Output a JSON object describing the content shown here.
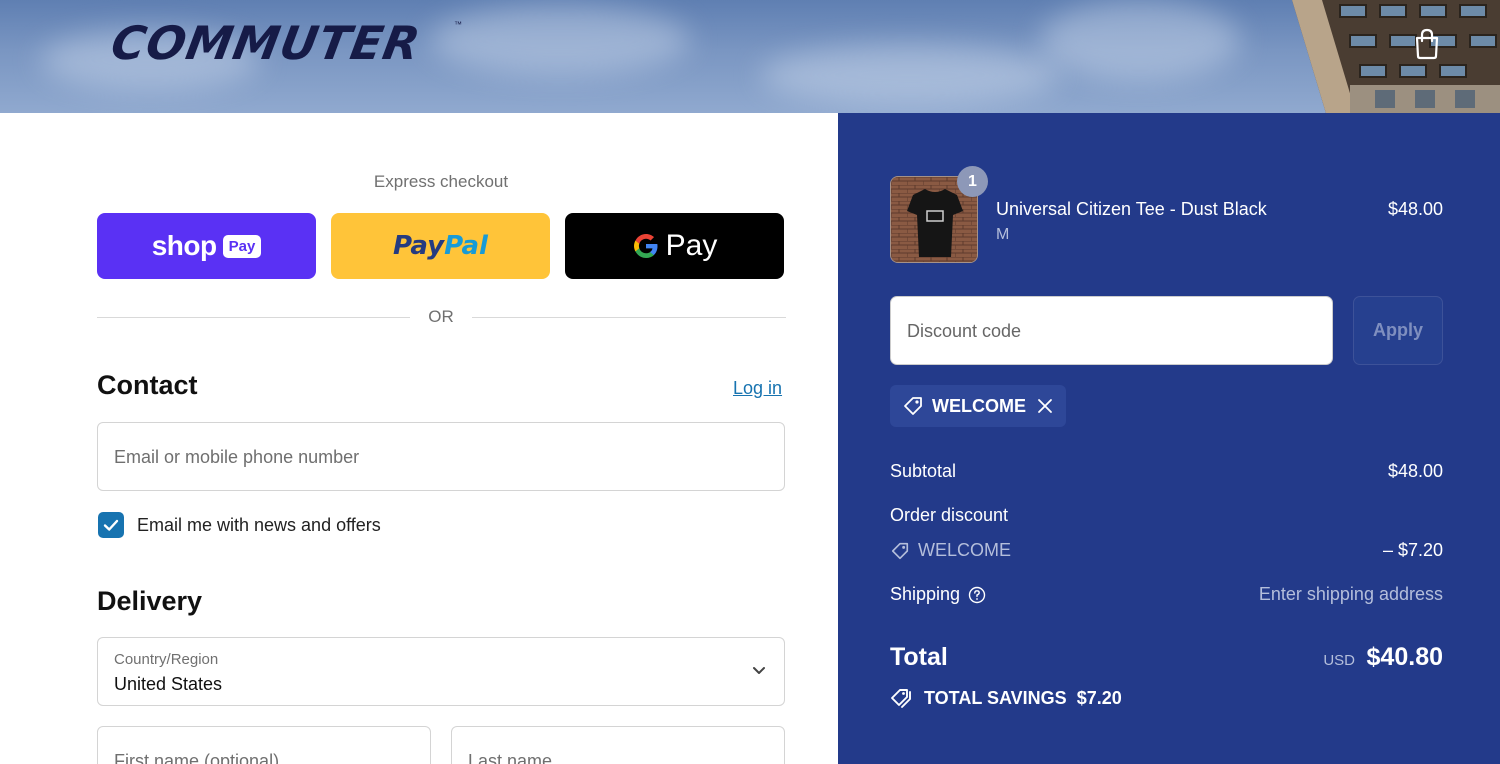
{
  "brand": {
    "logo_text": "COMMUTER",
    "logo_mark": "™"
  },
  "header": {
    "cart_icon": "shopping-bag-icon"
  },
  "express": {
    "title": "Express checkout",
    "shop_pay": {
      "shop": "shop",
      "pay": "Pay"
    },
    "paypal": {
      "part1": "Pay",
      "part2": "Pal"
    },
    "gpay": {
      "g": "G",
      "pay": "Pay"
    },
    "or_text": "OR"
  },
  "contact": {
    "title": "Contact",
    "login_label": "Log in",
    "email_placeholder": "Email or mobile phone number",
    "newsletter_label": "Email me with news and offers",
    "newsletter_checked": true
  },
  "delivery": {
    "title": "Delivery",
    "country_label": "Country/Region",
    "country_value": "United States",
    "first_name_placeholder": "First name (optional)",
    "last_name_placeholder": "Last name"
  },
  "summary": {
    "item": {
      "name": "Universal Citizen Tee - Dust Black",
      "variant": "M",
      "price": "$48.00",
      "quantity": "1"
    },
    "discount_placeholder": "Discount code",
    "apply_label": "Apply",
    "applied_code": "WELCOME",
    "subtotal_label": "Subtotal",
    "subtotal_value": "$48.00",
    "order_discount_label": "Order discount",
    "discount_code": "WELCOME",
    "discount_value": "– $7.20",
    "shipping_label": "Shipping",
    "shipping_value": "Enter shipping address",
    "total_label": "Total",
    "currency": "USD",
    "total_value": "$40.80",
    "savings_label": "TOTAL SAVINGS",
    "savings_value": "$7.20"
  },
  "colors": {
    "summary_bg": "#233a8a",
    "shop_pay": "#5a31f4",
    "paypal": "#ffc439",
    "gpay": "#000000",
    "link": "#1773b0"
  }
}
